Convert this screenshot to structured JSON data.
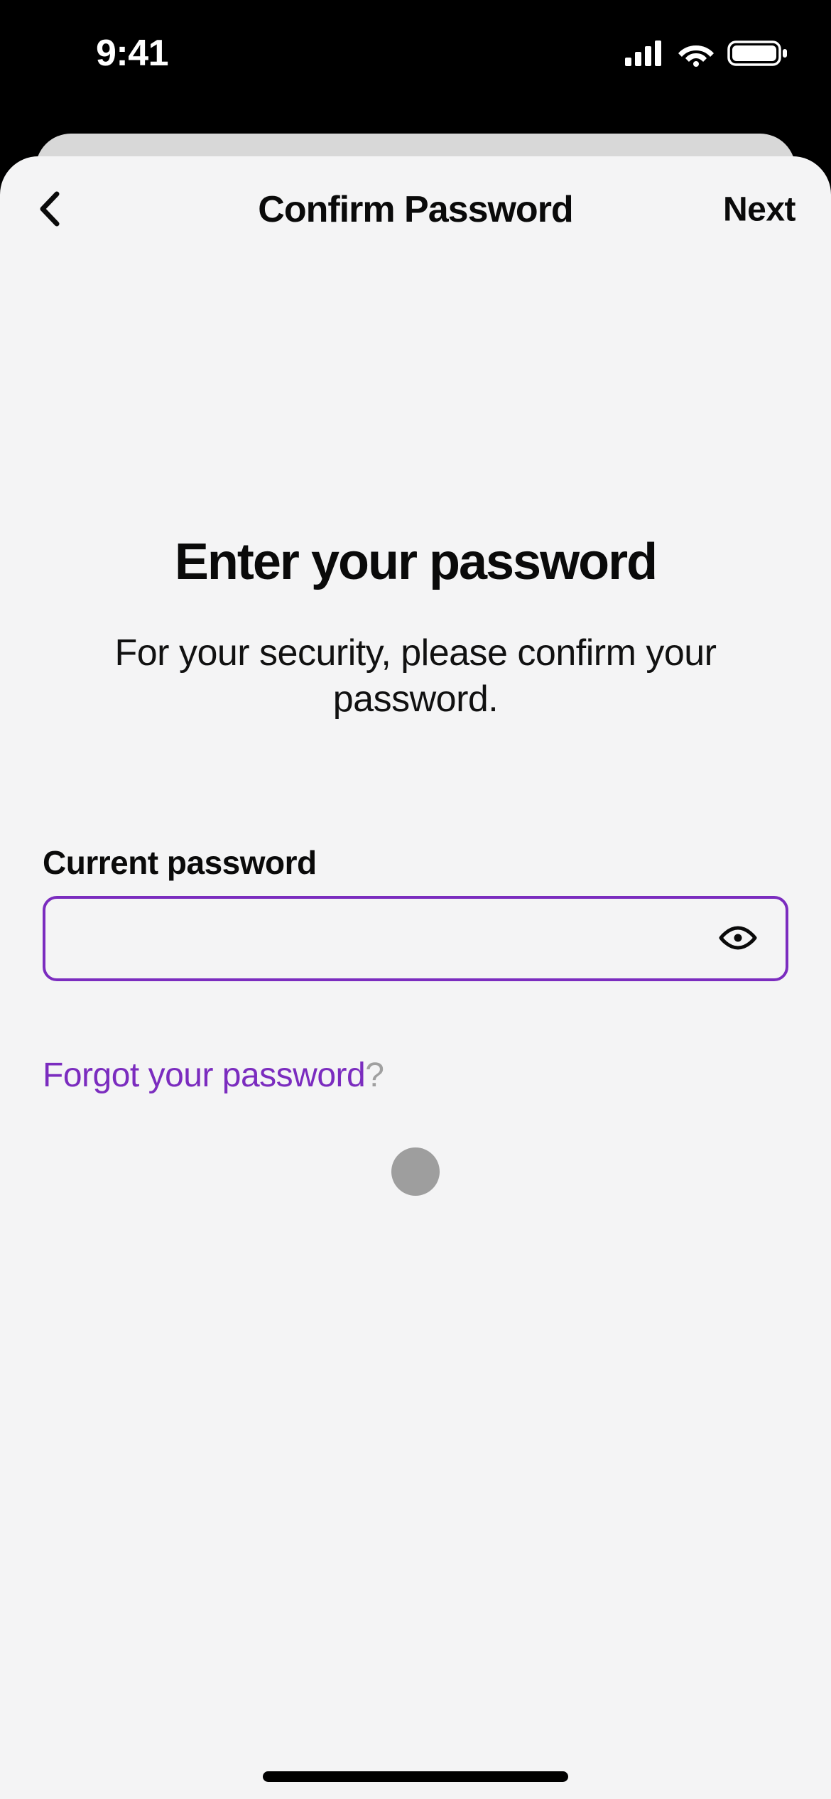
{
  "statusBar": {
    "time": "9:41"
  },
  "navbar": {
    "title": "Confirm Password",
    "next_label": "Next"
  },
  "main": {
    "heading": "Enter your password",
    "subheading": "For your security, please confirm your password."
  },
  "passwordField": {
    "label": "Current password",
    "value": "",
    "placeholder": ""
  },
  "forgot": {
    "text": "Forgot your password",
    "suffix": "?"
  },
  "colors": {
    "accent": "#7b2cbf"
  }
}
